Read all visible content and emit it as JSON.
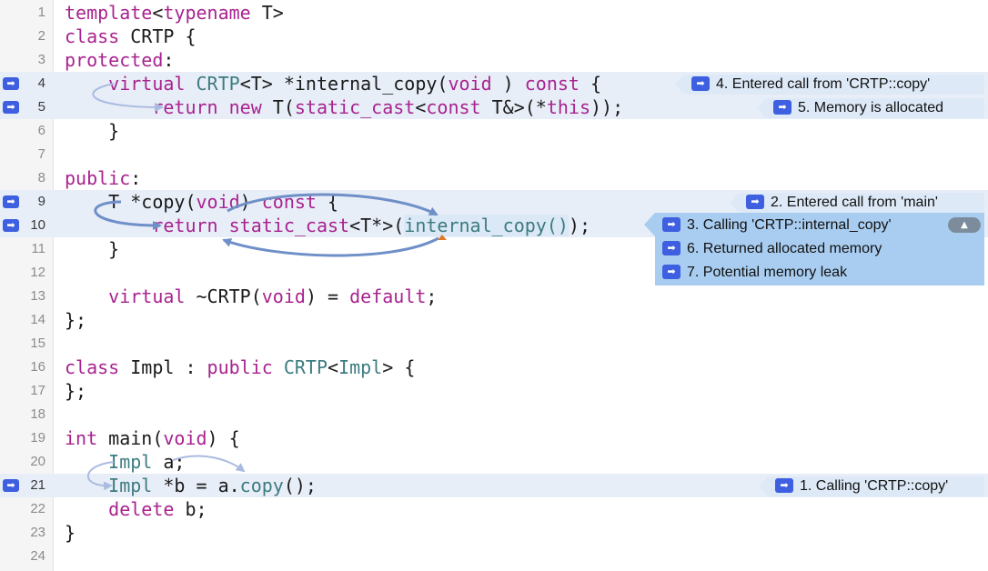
{
  "lines": [
    {
      "n": "1",
      "segs": [
        [
          "kw",
          "template"
        ],
        [
          "",
          "<"
        ],
        [
          "kw",
          "typename"
        ],
        [
          "",
          " T>"
        ]
      ]
    },
    {
      "n": "2",
      "segs": [
        [
          "kw",
          "class"
        ],
        [
          "",
          " CRTP {"
        ]
      ]
    },
    {
      "n": "3",
      "segs": [
        [
          "kw",
          "protected"
        ],
        [
          "",
          ":"
        ]
      ]
    },
    {
      "n": "4",
      "bp": true,
      "hl": true,
      "segs": [
        [
          "",
          "    "
        ],
        [
          "kw",
          "virtual"
        ],
        [
          "",
          " "
        ],
        [
          "ty",
          "CRTP"
        ],
        [
          "",
          "<T> *internal_copy("
        ],
        [
          "kw",
          "void"
        ],
        [
          "",
          " ) "
        ],
        [
          "kw",
          "const"
        ],
        [
          "",
          " {"
        ]
      ]
    },
    {
      "n": "5",
      "bp": true,
      "hl": true,
      "segs": [
        [
          "",
          "        "
        ],
        [
          "kw",
          "return"
        ],
        [
          "",
          " "
        ],
        [
          "kw",
          "new"
        ],
        [
          "",
          " T("
        ],
        [
          "kw",
          "static_cast"
        ],
        [
          "",
          "<"
        ],
        [
          "kw",
          "const"
        ],
        [
          "",
          " T&>(*"
        ],
        [
          "kw",
          "this"
        ],
        [
          "",
          "));"
        ]
      ]
    },
    {
      "n": "6",
      "segs": [
        [
          "",
          "    }"
        ]
      ]
    },
    {
      "n": "7",
      "segs": []
    },
    {
      "n": "8",
      "segs": [
        [
          "kw",
          "public"
        ],
        [
          "",
          ":"
        ]
      ]
    },
    {
      "n": "9",
      "bp": true,
      "hl": true,
      "segs": [
        [
          "",
          "    T *copy("
        ],
        [
          "kw",
          "void"
        ],
        [
          "",
          ") "
        ],
        [
          "kw",
          "const"
        ],
        [
          "",
          " {"
        ]
      ]
    },
    {
      "n": "10",
      "bp": true,
      "hl": true,
      "segs": [
        [
          "",
          "        "
        ],
        [
          "kw",
          "return"
        ],
        [
          "",
          " "
        ],
        [
          "kw",
          "static_cast"
        ],
        [
          "",
          "<T*>("
        ],
        [
          "cb",
          "internal_copy()"
        ],
        [
          "",
          ");"
        ]
      ]
    },
    {
      "n": "11",
      "segs": [
        [
          "",
          "    }"
        ]
      ]
    },
    {
      "n": "12",
      "segs": []
    },
    {
      "n": "13",
      "segs": [
        [
          "",
          "    "
        ],
        [
          "kw",
          "virtual"
        ],
        [
          "",
          " ~CRTP("
        ],
        [
          "kw",
          "void"
        ],
        [
          "",
          ") = "
        ],
        [
          "kw",
          "default"
        ],
        [
          "",
          ";"
        ]
      ]
    },
    {
      "n": "14",
      "segs": [
        [
          "",
          "};"
        ]
      ]
    },
    {
      "n": "15",
      "segs": []
    },
    {
      "n": "16",
      "segs": [
        [
          "kw",
          "class"
        ],
        [
          "",
          " Impl : "
        ],
        [
          "kw",
          "public"
        ],
        [
          "",
          " "
        ],
        [
          "ty",
          "CRTP"
        ],
        [
          "",
          "<"
        ],
        [
          "ty",
          "Impl"
        ],
        [
          "",
          "> {"
        ]
      ]
    },
    {
      "n": "17",
      "segs": [
        [
          "",
          "};"
        ]
      ]
    },
    {
      "n": "18",
      "segs": []
    },
    {
      "n": "19",
      "segs": [
        [
          "kw",
          "int"
        ],
        [
          "",
          " main("
        ],
        [
          "kw",
          "void"
        ],
        [
          "",
          ") {"
        ]
      ]
    },
    {
      "n": "20",
      "segs": [
        [
          "",
          "    "
        ],
        [
          "ty",
          "Impl"
        ],
        [
          "",
          " a;"
        ]
      ]
    },
    {
      "n": "21",
      "bp": true,
      "hl": true,
      "segs": [
        [
          "",
          "    "
        ],
        [
          "ty",
          "Impl"
        ],
        [
          "",
          " *b = a."
        ],
        [
          "ty",
          "copy"
        ],
        [
          "",
          "();"
        ]
      ]
    },
    {
      "n": "22",
      "segs": [
        [
          "",
          "    "
        ],
        [
          "kw",
          "delete"
        ],
        [
          "",
          " b;"
        ]
      ]
    },
    {
      "n": "23",
      "segs": [
        [
          "",
          "}"
        ]
      ]
    },
    {
      "n": "24",
      "segs": []
    }
  ],
  "notes": {
    "step4": "4. Entered call from 'CRTP::copy'",
    "step5": "5. Memory is allocated",
    "step2": "2. Entered call from 'main'",
    "step3": "3. Calling 'CRTP::internal_copy'",
    "step6": "6. Returned allocated memory",
    "step7": "7. Potential memory leak",
    "step1": "1. Calling 'CRTP::copy'"
  },
  "icons": {
    "breakpoint_marker": "right-arrow-icon",
    "note_icon": "right-arrow-icon",
    "collapse": "triangle-up-icon"
  },
  "colors": {
    "keyword": "#a8238f",
    "type": "#3d7b80",
    "marker": "#3d5fe0",
    "arrow": "#6f8fc8"
  }
}
